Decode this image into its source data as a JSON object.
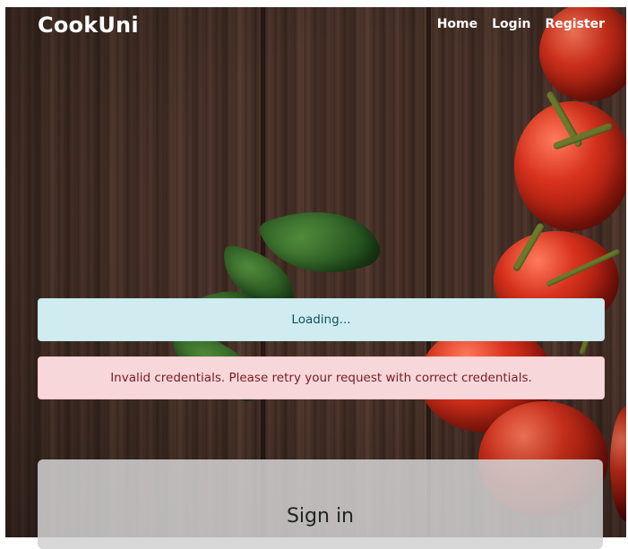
{
  "navbar": {
    "brand": "CookUni",
    "links": [
      "Home",
      "Login",
      "Register"
    ]
  },
  "alerts": {
    "info": "Loading...",
    "error": "Invalid credentials. Please retry your request with correct credentials."
  },
  "form": {
    "title": "Sign in"
  },
  "colors": {
    "info_bg": "#d1ecf1",
    "info_text": "#0c5460",
    "error_bg": "#f8d7da",
    "error_text": "#721c24"
  }
}
